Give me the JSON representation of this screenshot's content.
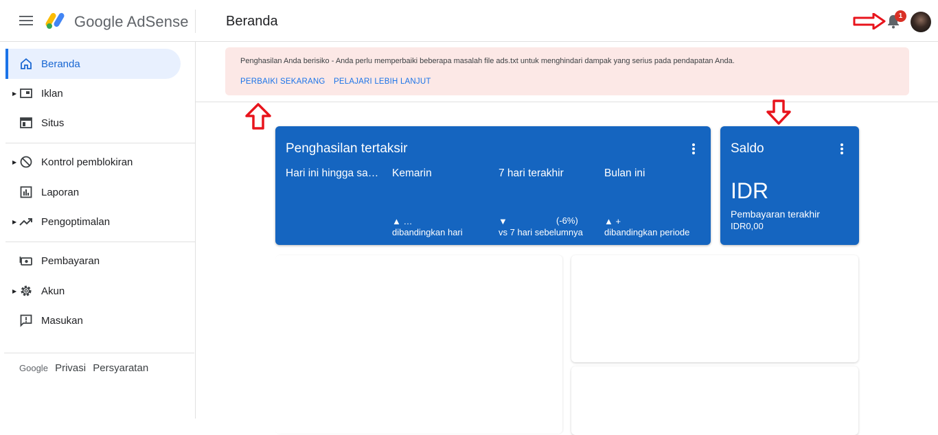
{
  "header": {
    "logo_text": "Google AdSense",
    "title": "Beranda",
    "notification_count": "1"
  },
  "sidebar": {
    "items": [
      {
        "label": "Beranda",
        "icon": "home-icon"
      },
      {
        "label": "Iklan",
        "icon": "ads-icon"
      },
      {
        "label": "Situs",
        "icon": "sites-icon"
      },
      {
        "label": "Kontrol pemblokiran",
        "icon": "block-icon"
      },
      {
        "label": "Laporan",
        "icon": "report-icon"
      },
      {
        "label": "Pengoptimalan",
        "icon": "trending-icon"
      },
      {
        "label": "Pembayaran",
        "icon": "payment-icon"
      },
      {
        "label": "Akun",
        "icon": "gear-icon"
      },
      {
        "label": "Masukan",
        "icon": "feedback-icon"
      }
    ],
    "footer": {
      "brand": "Google",
      "privacy": "Privasi",
      "terms": "Persyaratan"
    }
  },
  "alert": {
    "message": "Penghasilan Anda berisiko - Anda perlu memperbaiki beberapa masalah file ads.txt untuk menghindari dampak yang serius pada pendapatan Anda.",
    "fix_label": "PERBAIKI SEKARANG",
    "learn_label": "PELAJARI LEBIH LANJUT"
  },
  "earnings_card": {
    "title": "Penghasilan tertaksir",
    "columns": [
      {
        "heading": "Hari ini hingga sa…",
        "line1": "",
        "line2": ""
      },
      {
        "heading": "Kemarin",
        "line1": "▲ …",
        "line2": "dibandingkan hari"
      },
      {
        "heading": "7 hari terakhir",
        "line1": "▼",
        "change": "(-6%)",
        "line2": "vs 7 hari sebelumnya"
      },
      {
        "heading": "Bulan ini",
        "line1": "▲ +",
        "line2": "dibandingkan periode"
      }
    ]
  },
  "balance_card": {
    "title": "Saldo",
    "amount": "IDR",
    "last_payment_label": "Pembayaran terakhir",
    "last_payment_value": "IDR0,00"
  },
  "colors": {
    "primary": "#1565c0",
    "alert_bg": "#fce8e6",
    "link": "#1a73e8",
    "annotation_red": "#e8141c"
  }
}
